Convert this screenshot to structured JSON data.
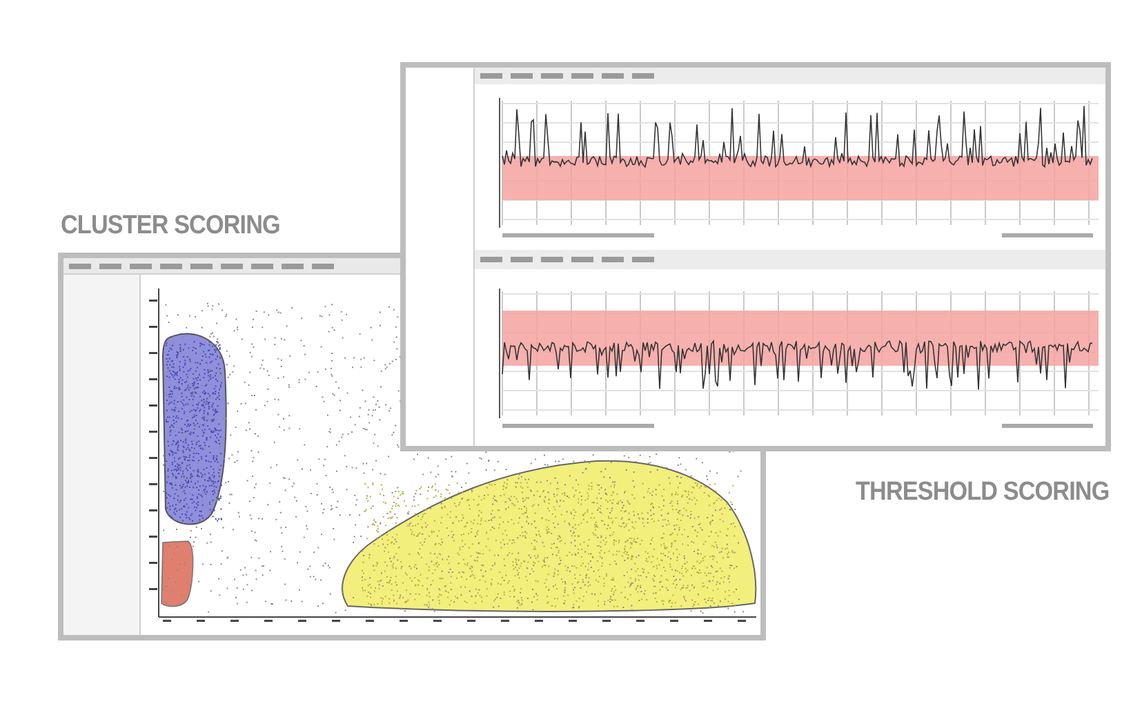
{
  "cluster_scoring": {
    "caption": "CLUSTER SCORING"
  },
  "threshold_scoring": {
    "caption": "THRESHOLD SCORING"
  }
}
